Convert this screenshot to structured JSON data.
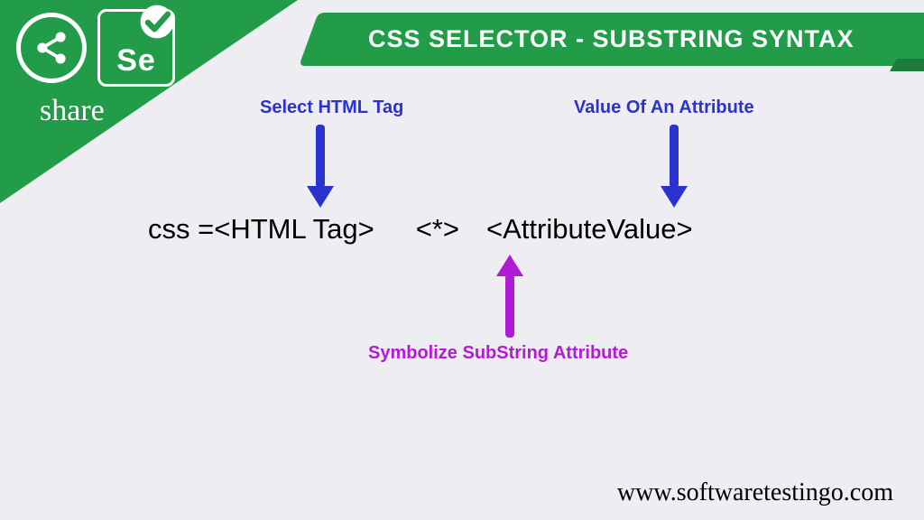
{
  "logo": {
    "share_label": "share",
    "se_text": "Se"
  },
  "title": "CSS SELECTOR - SUBSTRING SYNTAX",
  "annotations": {
    "html_tag": "Select HTML Tag",
    "attr_value": "Value Of An Attribute",
    "substring": "Symbolize SubString Attribute"
  },
  "syntax": {
    "prefix": "css = ",
    "part_html_tag": "<HTML Tag>",
    "part_star": "<*>",
    "part_attr_value": "<AttributeValue>"
  },
  "footer": "www.softwaretestingo.com"
}
